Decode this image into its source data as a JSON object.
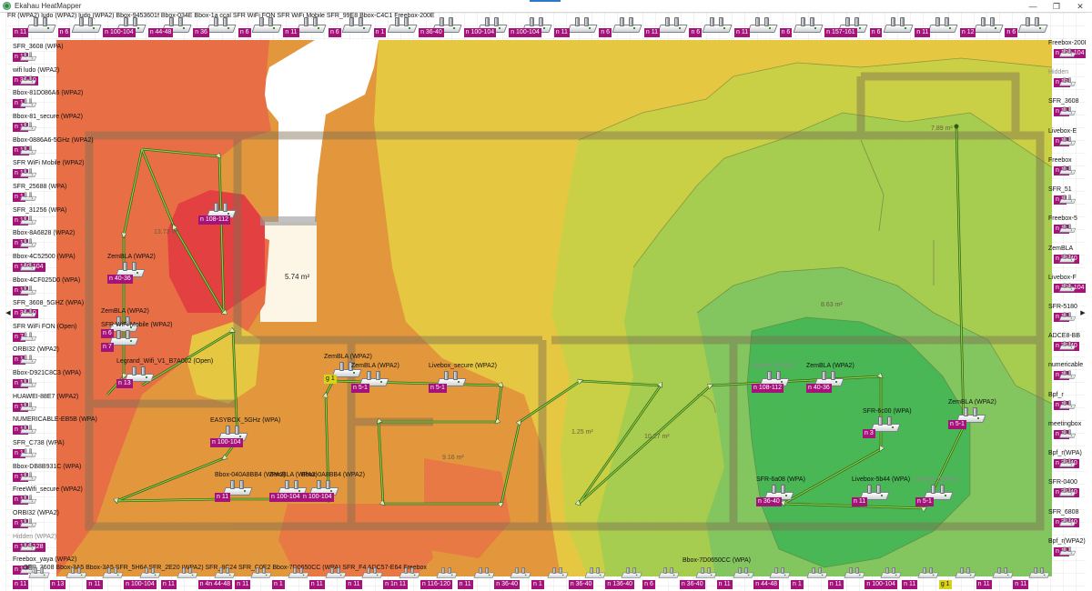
{
  "window": {
    "title": "Ekahau HeatMapper",
    "icon": "ekahau-app-icon"
  },
  "controls": {
    "minimize": "—",
    "restore": "❐",
    "close": "✕"
  },
  "arrows": {
    "left": "◀",
    "right": "▶"
  },
  "areas": [
    "5.74 m²",
    "13.73 m²",
    "7.89 m²",
    "8.63 m²",
    "10.27 m²",
    "1.25 m²",
    "9.16 m²"
  ],
  "top_strip": "FR (WPA2)   ludo (WPA2)   ludo (WPA2)   Bbox-9453601f   Bbox-034E   Bbox-1a   ccal   SFR WiFi FON   SFR WiFi Mobile   SFR_99E8   Bbox-C4C1   Freebox-200E",
  "top_channels": [
    "n 11",
    "n 6",
    "n 100-104",
    "n 44-48",
    "n 36",
    "n 6",
    "n 11",
    "n 6",
    "n 1",
    "n 36-40",
    "n 100-104",
    "n 100-104",
    "n 11",
    "n 6",
    "n 11",
    "n 6",
    "n 11",
    "n 6",
    "n 157-161",
    "n 6",
    "n 11",
    "n 12",
    "n 6"
  ],
  "left_list": [
    {
      "ssid": "SFR_3608 (WPA)",
      "chan": "n 11"
    },
    {
      "ssid": "wifi ludo (WPA2)",
      "chan": "n 36-40"
    },
    {
      "ssid": "Bbox-81D086A6 (WPA2)",
      "chan": "n 1"
    },
    {
      "ssid": "Bbox-81_secure (WPA2)",
      "chan": "n 11"
    },
    {
      "ssid": "Bbox-0886A6-5GHz (WPA2)",
      "chan": "n 13"
    },
    {
      "ssid": "SFR WiFi Mobile (WPA2)",
      "chan": "n 11"
    },
    {
      "ssid": "SFR_25688 (WPA)",
      "chan": "n 1"
    },
    {
      "ssid": "SFR_31256 (WPA)",
      "chan": "n 11"
    },
    {
      "ssid": "Bbox-8A6828 (WPA2)",
      "chan": "n 11"
    },
    {
      "ssid": "Bbox-4C52500 (WPA)",
      "chan": "n 100-104"
    },
    {
      "ssid": "Bbox-4CF025D0 (WPA)",
      "chan": "n 11"
    },
    {
      "ssid": "SFR_3608_5GHZ (WPA)",
      "chan": "n 36-40"
    },
    {
      "ssid": "SFR WiFi FON (Open)",
      "chan": "n 7"
    },
    {
      "ssid": "ORBI32 (WPA2)",
      "chan": "n 1"
    },
    {
      "ssid": "Bbox-D921C8C3 (WPA)",
      "chan": "n 11"
    },
    {
      "ssid": "HUAWEI-88E7 (WPA2)",
      "chan": "n 11"
    },
    {
      "ssid": "NUMERICABLE-EB5B (WPA)",
      "chan": "n 11"
    },
    {
      "ssid": "SFR_C738 (WPA)",
      "chan": "n 1"
    },
    {
      "ssid": "Bbox-DB8B931C (WPA)",
      "chan": "n 11"
    },
    {
      "ssid": "FreeWifi_secure (WPA2)",
      "chan": "n 11"
    },
    {
      "ssid": "ORBI32 (WPA2)",
      "chan": "n 11"
    },
    {
      "ssid": "Hidden (WPA2)",
      "chan": "n 124-128"
    },
    {
      "ssid": "Freebox_yaya (WPA2)",
      "chan": "n 11"
    }
  ],
  "right_list": [
    {
      "ssid": "Freebox-200E",
      "chan": "n 100-104"
    },
    {
      "ssid": "Hidden",
      "chan": "n 12"
    },
    {
      "ssid": "SFR_3608",
      "chan": "n 11"
    },
    {
      "ssid": "Livebox-E",
      "chan": "n 11"
    },
    {
      "ssid": "Freebox",
      "chan": "n 11"
    },
    {
      "ssid": "SFR_51",
      "chan": "n 1"
    },
    {
      "ssid": "Freebox-5",
      "chan": "n 11"
    },
    {
      "ssid": "ZemBLA",
      "chan": "n 36-40"
    },
    {
      "ssid": "Livebox-F",
      "chan": "n 100-104"
    },
    {
      "ssid": "SFR-5180",
      "chan": "n 11"
    },
    {
      "ssid": "ADCE8-BB",
      "chan": "n 36-40"
    },
    {
      "ssid": "numericable",
      "chan": "n 11"
    },
    {
      "ssid": "Bpf_r",
      "chan": "n 11"
    },
    {
      "ssid": "meetingbox",
      "chan": "n 11"
    },
    {
      "ssid": "Bpf_r(WPA)",
      "chan": "n 36-40"
    },
    {
      "ssid": "SFR-0400",
      "chan": "n 36-40"
    },
    {
      "ssid": "SFR_6808",
      "chan": "n 36-40"
    },
    {
      "ssid": "Bpf_r(WPA2)",
      "chan": "n 11"
    }
  ],
  "map_aps": [
    {
      "ssid": "ZemBLA (WPA2)",
      "chan": "n 40-36"
    },
    {
      "ssid": "ZemBLA (WPA2)",
      "chan": "n 6"
    },
    {
      "ssid": "SFR WiFi Mobile (WPA2)",
      "chan": "n 7"
    },
    {
      "ssid": "Legrand_Wifi_V1_B7A002 (Open)",
      "chan": "n 13"
    },
    {
      "ssid": "",
      "chan": "n 108-112"
    },
    {
      "ssid": "EASYBOX_5GHz (WPA)",
      "chan": "n 100-104"
    },
    {
      "ssid": "Bbox-040A8BB4 (WPA2)",
      "chan": "n 11"
    },
    {
      "ssid": "ZemBLA (WPA2)",
      "chan": "n 100-104"
    },
    {
      "ssid": "Bbox-0A8BB4 (WPA2)",
      "chan": "n 100-104"
    },
    {
      "ssid": "ZemBLA (WPA2)",
      "chan": "g 1"
    },
    {
      "ssid": "ZemBLA (WPA2)",
      "chan": "n 5-1"
    },
    {
      "ssid": "Livebox_secure (WPA2)",
      "chan": "n 5-1"
    },
    {
      "ssid": "Hidden (WPA2)",
      "chan": "n 108-112"
    },
    {
      "ssid": "ZemBLA (WPA2)",
      "chan": "n 40-36"
    },
    {
      "ssid": "SFR-6c00 (WPA)",
      "chan": "n 3"
    },
    {
      "ssid": "ZemBLA (WPA2)",
      "chan": "n 5-1"
    },
    {
      "ssid": "SFR-6a08 (WPA)",
      "chan": "n 36-40"
    },
    {
      "ssid": "Livebox-5b44 (WPA)",
      "chan": "n 11"
    },
    {
      "ssid": "Hidden (WPA2)",
      "chan": "n 5-1"
    }
  ],
  "bottom_strip": "SFR_3608   Bbox-3A5   Bbox-3A5   SFR_5H64   SFR_2E20 (WPA2)   SFR_8C24   SFR_C0E2   Bbox-7D0650CC (WPA)   SFR_F4   ADC57-E64   Freebox",
  "bottom_label": "Bbox-7D0650CC (WPA)",
  "bottom_channels": [
    "n 11",
    "n 13",
    "n 11",
    "n 100-104",
    "n 11",
    "n 4n 44-48",
    "n 11",
    "n 1",
    "n 11",
    "n 11",
    "n 1n 11",
    "n 116-120",
    "n 11",
    "n 36-40",
    "n 1",
    "n 36-40",
    "n 136-40",
    "n 6",
    "n 36-40",
    "n 11",
    "n 44-48",
    "n 1",
    "n 11",
    "n 100-104",
    "n 11",
    "g 1",
    "n 11",
    "n 11"
  ]
}
